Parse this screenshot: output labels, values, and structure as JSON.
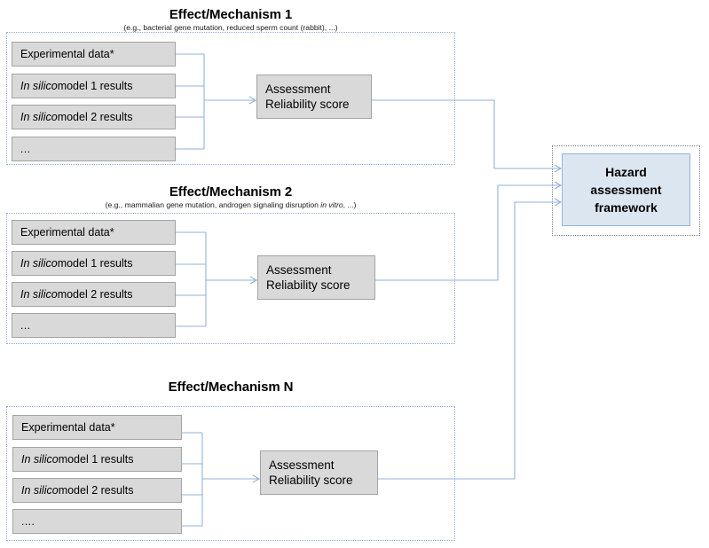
{
  "diagram": {
    "title_hidden": "Hazard assessment framework flow diagram",
    "colors": {
      "box_fill": "#d9d9d9",
      "box_border": "#a3a3a3",
      "hazard_fill": "#dce6f1",
      "hazard_border": "#95b3d7",
      "connector": "#94b2d6",
      "group_border": "#8faadc"
    }
  },
  "sections": [
    {
      "title": "Effect/Mechanism 1",
      "subtitle_pre": "(e.g., bacterial gene mutation, reduced sperm count (rabbit), ...)",
      "subtitle_italic": "",
      "subtitle_post": "",
      "inputs": [
        {
          "pre": "",
          "italic": "",
          "post": "Experimental data*"
        },
        {
          "pre": "",
          "italic": "In silico",
          "post": " model 1 results"
        },
        {
          "pre": "",
          "italic": "In silico",
          "post": " model 2 results"
        },
        {
          "pre": "",
          "italic": "",
          "post": "..."
        }
      ],
      "assessment_line1": "Assessment",
      "assessment_line2": "Reliability score"
    },
    {
      "title": "Effect/Mechanism 2",
      "subtitle_pre": "(e.g., mammalian gene mutation, androgen signaling disruption ",
      "subtitle_italic": "in vitro",
      "subtitle_post": ", ...)",
      "inputs": [
        {
          "pre": "",
          "italic": "",
          "post": "Experimental data*"
        },
        {
          "pre": "",
          "italic": "In silico",
          "post": " model 1 results"
        },
        {
          "pre": "",
          "italic": "In silico",
          "post": " model 2 results"
        },
        {
          "pre": "",
          "italic": "",
          "post": "..."
        }
      ],
      "assessment_line1": "Assessment",
      "assessment_line2": "Reliability score"
    },
    {
      "title": "Effect/Mechanism N",
      "subtitle_pre": "",
      "subtitle_italic": "",
      "subtitle_post": "",
      "inputs": [
        {
          "pre": "",
          "italic": "",
          "post": "Experimental data*"
        },
        {
          "pre": "",
          "italic": "In silico",
          "post": " model 1 results"
        },
        {
          "pre": "",
          "italic": "In silico",
          "post": " model 2 results"
        },
        {
          "pre": "",
          "italic": "",
          "post": "...."
        }
      ],
      "assessment_line1": "Assessment",
      "assessment_line2": "Reliability score"
    }
  ],
  "hazard": {
    "line1": "Hazard",
    "line2": "assessment",
    "line3": "framework"
  }
}
